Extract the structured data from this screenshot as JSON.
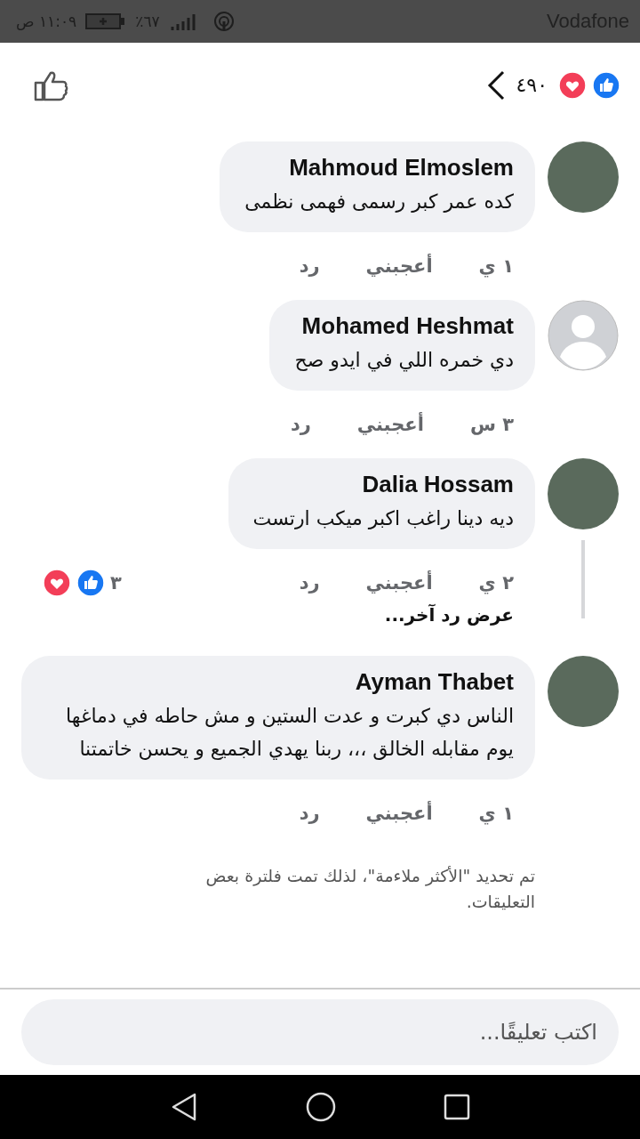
{
  "status_bar": {
    "carrier": "Vodafone",
    "time": "١١:٠٩ ص",
    "battery": "٪٦٧"
  },
  "header": {
    "reaction_count": "٤٩٠"
  },
  "comments": [
    {
      "author": "Mahmoud Elmoslem",
      "avatar": {
        "kind": "photo"
      },
      "text": "كده عمر كبر رسمى فهمى نظمى",
      "time": "١ ي",
      "like": "أعجبني",
      "reply": "رد"
    },
    {
      "author": "Mohamed Heshmat",
      "avatar": {
        "kind": "default"
      },
      "text": "دي خمره اللي في ايدو صح",
      "time": "٣ س",
      "like": "أعجبني",
      "reply": "رد"
    },
    {
      "author": "Dalia Hossam",
      "avatar": {
        "kind": "photo"
      },
      "text": "ديه دينا راغب اكبر ميكب ارتست",
      "time": "٢ ي",
      "like": "أعجبني",
      "reply": "رد",
      "reaction_count": "٣",
      "more_replies": "عرض رد آخر..."
    },
    {
      "author": "Ayman Thabet",
      "avatar": {
        "kind": "photo"
      },
      "text": "الناس دي كبرت و عدت الستين و مش حاطه في دماغها يوم مقابله الخالق ،،، ربنا يهدي الجميع و يحسن خاتمتنا",
      "time": "١ ي",
      "like": "أعجبني",
      "reply": "رد"
    }
  ],
  "filter_notice": "تم تحديد \"الأكثر ملاءمة\"، لذلك تمت فلترة بعض التعليقات.",
  "composer": {
    "placeholder": "اكتب تعليقًا..."
  }
}
